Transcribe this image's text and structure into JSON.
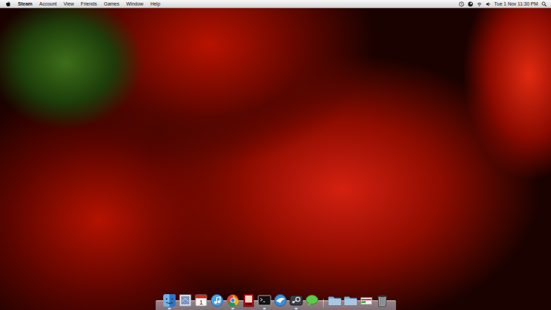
{
  "menu_bar": {
    "app": "Steam",
    "items": [
      {
        "label": "Account"
      },
      {
        "label": "View"
      },
      {
        "label": "Friends"
      },
      {
        "label": "Games"
      },
      {
        "label": "Window"
      },
      {
        "label": "Help"
      }
    ],
    "clock": "Tue 1 Nov 11:30 PM"
  },
  "dock": {
    "items": [
      {
        "kind": "finder",
        "running": true
      },
      {
        "kind": "mail",
        "running": false
      },
      {
        "kind": "calendar",
        "running": false,
        "text": "1"
      },
      {
        "kind": "itunes",
        "running": false
      },
      {
        "kind": "chrome",
        "running": true
      },
      {
        "kind": "photobooth",
        "running": false
      },
      {
        "kind": "terminal",
        "running": true
      },
      {
        "kind": "bird",
        "running": false
      },
      {
        "kind": "steam",
        "running": true
      },
      {
        "kind": "messages",
        "running": false
      },
      {
        "kind": "separator",
        "running": false
      },
      {
        "kind": "applications",
        "running": false
      },
      {
        "kind": "documents",
        "running": false
      },
      {
        "kind": "stack",
        "running": false
      },
      {
        "kind": "trash",
        "running": false
      }
    ]
  }
}
